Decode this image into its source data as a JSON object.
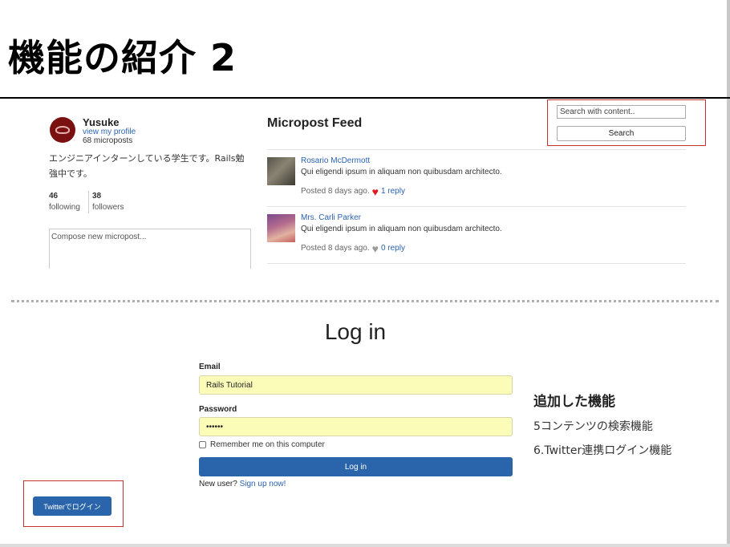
{
  "slide": {
    "title": "機能の紹介 2"
  },
  "profile": {
    "name": "Yusuke",
    "link": "view my profile",
    "micropost_count": "68 microposts",
    "bio": "エンジニアインターンしている学生です。Rails勉強中です。",
    "following_count": "46",
    "following_label": "following",
    "followers_count": "38",
    "followers_label": "followers",
    "compose_placeholder": "Compose new micropost..."
  },
  "feed": {
    "title": "Micropost Feed",
    "posts": [
      {
        "user": "Rosario McDermott",
        "text": "Qui eligendi ipsum in aliquam non quibusdam architecto.",
        "posted": "Posted 8 days ago.",
        "heart_color": "#e0191e",
        "replies": "1 reply"
      },
      {
        "user": "Mrs. Carli Parker",
        "text": "Qui eligendi ipsum in aliquam non quibusdam architecto.",
        "posted": "Posted 8 days ago.",
        "heart_color": "#9a9a9a",
        "replies": "0 reply"
      }
    ]
  },
  "search": {
    "placeholder": "Search with content..",
    "button": "Search"
  },
  "login": {
    "heading": "Log in",
    "email_label": "Email",
    "email_value": "Rails Tutorial",
    "password_label": "Password",
    "password_value": "••••••",
    "remember_label": "Remember me on this computer",
    "button": "Log in",
    "new_user_text": "New user?",
    "signup_link": "Sign up now!"
  },
  "features": {
    "title": "追加した機能",
    "items": [
      "5コンテンツの検索機能",
      "6.Twitter連携ログイン機能"
    ]
  },
  "twitter": {
    "button": "Twitterでログイン"
  },
  "colors": {
    "highlight_box": "#c4302b",
    "primary_button": "#2a64aa",
    "link": "#2a63b0",
    "autofill": "#fbfcb8"
  }
}
